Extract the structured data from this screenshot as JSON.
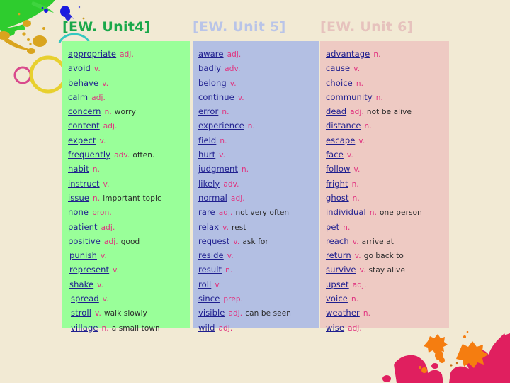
{
  "slide": {
    "background_color": "#f2ead4",
    "decorations": {
      "brush_stroke_color": "#2ecc2e",
      "ink_blue_color": "#1a1ae0",
      "gold_splatter_color": "#d9a41e",
      "pink_ring_color": "#d94a8c",
      "yellow_ring_color": "#e8d02e",
      "teal_arc_color": "#35c8c0",
      "crimson_splatter_color": "#e01f5f",
      "orange_splatter_color": "#f57d10"
    }
  },
  "headers": [
    {
      "label": "[EW. Unit4]",
      "color": "#1aa84a"
    },
    {
      "label": "[EW. Unit 5]",
      "color": "#b9c4e8"
    },
    {
      "label": "[EW. Unit 6]",
      "color": "#e6c2bd"
    }
  ],
  "columns": [
    {
      "unit": "[EW. Unit4]",
      "panel_color": "#99ff99",
      "entries": [
        {
          "word": "appropriate",
          "pos": "adj.",
          "def": ""
        },
        {
          "word": "avoid",
          "pos": "v.",
          "def": ""
        },
        {
          "word": "behave",
          "pos": "v.",
          "def": ""
        },
        {
          "word": "calm",
          "pos": "adj.",
          "def": ""
        },
        {
          "word": "concern",
          "pos": "n.",
          "def": "worry"
        },
        {
          "word": "content",
          "pos": "adj.",
          "def": ""
        },
        {
          "word": "expect",
          "pos": "v.",
          "def": ""
        },
        {
          "word": "frequently",
          "pos": "adv.",
          "def": "often."
        },
        {
          "word": "habit",
          "pos": "n.",
          "def": ""
        },
        {
          "word": "instruct",
          "pos": "v.",
          "def": ""
        },
        {
          "word": "issue",
          "pos": "n.",
          "def": "important topic"
        },
        {
          "word": "none",
          "pos": "pron.",
          "def": ""
        },
        {
          "word": "patient",
          "pos": "adj.",
          "def": ""
        },
        {
          "word": "positive",
          "pos": "adj.",
          "def": "good"
        },
        {
          "word": "punish",
          "pos": "v.",
          "def": ""
        },
        {
          "word": "represent",
          "pos": "v.",
          "def": ""
        },
        {
          "word": "shake",
          "pos": "v.",
          "def": ""
        },
        {
          "word": "spread",
          "pos": "v.",
          "def": ""
        },
        {
          "word": "stroll",
          "pos": "v.",
          "def": "walk slowly"
        },
        {
          "word": "village",
          "pos": "n.",
          "def": "a small town"
        }
      ]
    },
    {
      "unit": "[EW. Unit 5]",
      "panel_color": "#b3bfe3",
      "entries": [
        {
          "word": "aware",
          "pos": "adj.",
          "def": ""
        },
        {
          "word": "badly",
          "pos": "adv.",
          "def": ""
        },
        {
          "word": "belong",
          "pos": "v.",
          "def": ""
        },
        {
          "word": "continue",
          "pos": "v.",
          "def": ""
        },
        {
          "word": "error",
          "pos": "n.",
          "def": ""
        },
        {
          "word": "experience",
          "pos": "n.",
          "def": ""
        },
        {
          "word": "field",
          "pos": "n.",
          "def": ""
        },
        {
          "word": "hurt",
          "pos": "v.",
          "def": ""
        },
        {
          "word": "judgment",
          "pos": "n.",
          "def": ""
        },
        {
          "word": "likely",
          "pos": "adv.",
          "def": ""
        },
        {
          "word": "normal",
          "pos": "adj.",
          "def": ""
        },
        {
          "word": "rare",
          "pos": "adj.",
          "def": "not very often"
        },
        {
          "word": "relax",
          "pos": "v.",
          "def": "rest"
        },
        {
          "word": "request",
          "pos": "v.",
          "def": "ask for"
        },
        {
          "word": "reside",
          "pos": "v.",
          "def": ""
        },
        {
          "word": "result",
          "pos": "n.",
          "def": ""
        },
        {
          "word": "roll",
          "pos": "v.",
          "def": ""
        },
        {
          "word": "since",
          "pos": "prep.",
          "def": ""
        },
        {
          "word": "visible",
          "pos": "adj.",
          "def": "can be seen"
        },
        {
          "word": "wild",
          "pos": "adj.",
          "def": ""
        }
      ]
    },
    {
      "unit": "[EW. Unit 6]",
      "panel_color": "#eecac3",
      "entries": [
        {
          "word": "advantage",
          "pos": "n.",
          "def": ""
        },
        {
          "word": "cause",
          "pos": "v.",
          "def": ""
        },
        {
          "word": "choice",
          "pos": "n.",
          "def": ""
        },
        {
          "word": "community",
          "pos": "n.",
          "def": ""
        },
        {
          "word": "dead",
          "pos": "adj.",
          "def": "not be alive"
        },
        {
          "word": "distance",
          "pos": "n.",
          "def": ""
        },
        {
          "word": "escape",
          "pos": "v.",
          "def": ""
        },
        {
          "word": "face",
          "pos": "v.",
          "def": ""
        },
        {
          "word": "follow",
          "pos": "v.",
          "def": ""
        },
        {
          "word": "fright",
          "pos": "n.",
          "def": ""
        },
        {
          "word": "ghost",
          "pos": "n.",
          "def": ""
        },
        {
          "word": "individual",
          "pos": "n.",
          "def": "one person"
        },
        {
          "word": "pet",
          "pos": "n.",
          "def": ""
        },
        {
          "word": "reach",
          "pos": "v.",
          "def": "arrive at"
        },
        {
          "word": "return",
          "pos": "v.",
          "def": "go back to"
        },
        {
          "word": "survive",
          "pos": "v.",
          "def": "stay alive"
        },
        {
          "word": "upset",
          "pos": "adj.",
          "def": ""
        },
        {
          "word": "voice",
          "pos": "n.",
          "def": ""
        },
        {
          "word": "weather",
          "pos": "n.",
          "def": ""
        },
        {
          "word": "wise",
          "pos": "adj.",
          "def": ""
        }
      ]
    }
  ]
}
